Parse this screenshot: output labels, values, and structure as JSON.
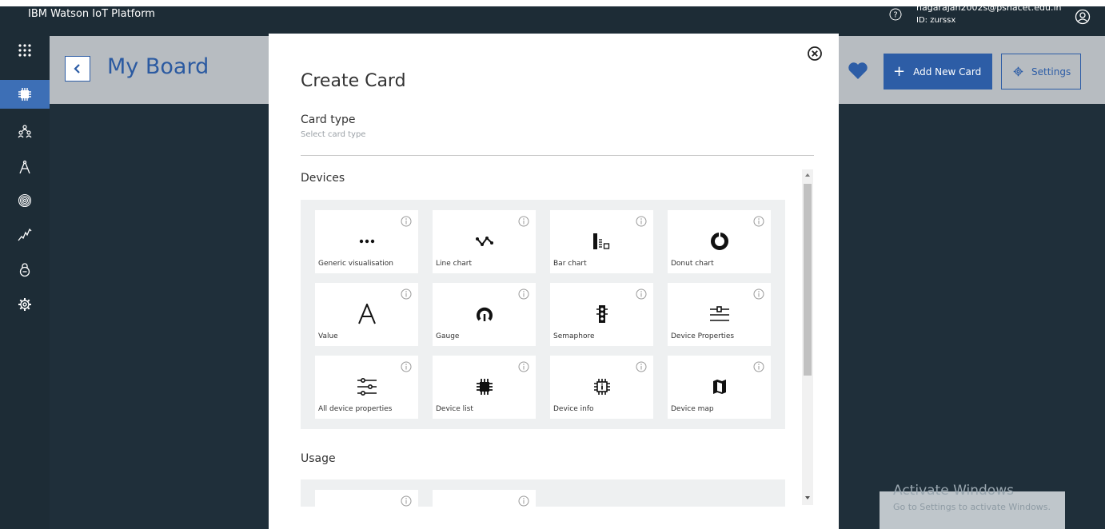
{
  "app": {
    "brand": "IBM Watson IoT Platform",
    "user_email": "nagarajan2002s@psnacet.edu.in",
    "user_id": "ID: zurssx"
  },
  "nav": {
    "items": [
      {
        "name": "apps-icon",
        "active": false
      },
      {
        "name": "devices-icon",
        "active": true
      },
      {
        "name": "members-icon",
        "active": false
      },
      {
        "name": "apps-compass-icon",
        "active": false
      },
      {
        "name": "fingerprint-icon",
        "active": false
      },
      {
        "name": "analytics-icon",
        "active": false
      },
      {
        "name": "security-icon",
        "active": false
      },
      {
        "name": "settings-icon",
        "active": false
      }
    ]
  },
  "board": {
    "title": "My Board",
    "add_card_label": "Add New Card",
    "settings_label": "Settings"
  },
  "modal": {
    "title": "Create Card",
    "card_type_label": "Card type",
    "card_type_hint": "Select card type",
    "sections": [
      {
        "title": "Devices",
        "tiles": [
          {
            "label": "Generic visualisation",
            "icon": "ellipsis-icon"
          },
          {
            "label": "Line chart",
            "icon": "line-chart-icon"
          },
          {
            "label": "Bar chart",
            "icon": "bar-chart-icon"
          },
          {
            "label": "Donut chart",
            "icon": "donut-chart-icon"
          },
          {
            "label": "Value",
            "icon": "value-icon"
          },
          {
            "label": "Gauge",
            "icon": "gauge-icon"
          },
          {
            "label": "Semaphore",
            "icon": "semaphore-icon"
          },
          {
            "label": "Device Properties",
            "icon": "device-properties-icon"
          },
          {
            "label": "All device properties",
            "icon": "all-device-properties-icon"
          },
          {
            "label": "Device list",
            "icon": "device-list-icon"
          },
          {
            "label": "Device info",
            "icon": "device-info-icon"
          },
          {
            "label": "Device map",
            "icon": "device-map-icon"
          }
        ]
      },
      {
        "title": "Usage",
        "tiles": [
          {
            "label": "",
            "icon": ""
          },
          {
            "label": "",
            "icon": ""
          }
        ]
      }
    ]
  },
  "watermark": {
    "title": "Activate Windows",
    "subtitle": "Go to Settings to activate Windows."
  },
  "colors": {
    "topbar": "#1d2c36",
    "accent": "#2d5da6",
    "header_band": "#b7bcc1"
  }
}
